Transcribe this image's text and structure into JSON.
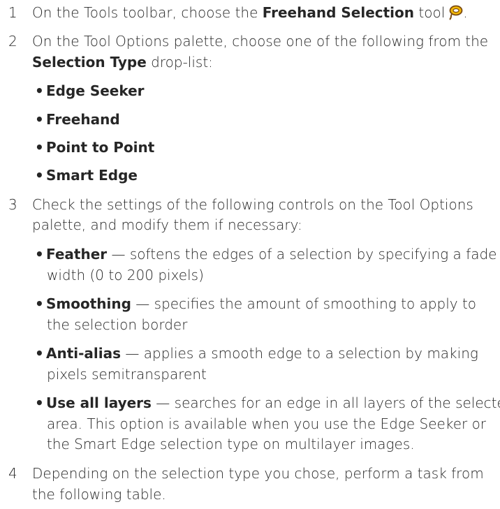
{
  "steps": [
    {
      "number": "1",
      "before": "On the Tools toolbar, choose the ",
      "keyword": "Freehand Selection",
      "after": " tool",
      "icon": "lasso-icon",
      "end": "."
    },
    {
      "number": "2",
      "line1": "On the Tool Options palette, choose one of the following from the",
      "keyword": "Selection Type",
      "line2_after": " drop-list:",
      "options": [
        "Edge Seeker",
        "Freehand",
        "Point to Point",
        "Smart Edge"
      ]
    },
    {
      "number": "3",
      "line1": "Check the settings of the following controls on the Tool Options",
      "line2": "palette, and modify them if necessary:",
      "controls": [
        {
          "name": "Feather",
          "line1": " — softens the edges of a selection by specifying a fade",
          "line2": "width (0 to 200 pixels)"
        },
        {
          "name": "Smoothing",
          "line1": " — specifies the amount of smoothing to apply to",
          "line2": "the selection border"
        },
        {
          "name": "Anti-alias",
          "line1": " — applies a smooth edge to a selection by making",
          "line2": "pixels semitransparent"
        },
        {
          "name": "Use all layers",
          "line1": " — searches for an edge in all layers of the selected",
          "line2": "area. This option is available when you use the Edge Seeker or",
          "line3": "the Smart Edge selection type on multilayer images."
        }
      ]
    },
    {
      "number": "4",
      "line1": "Depending on the selection type you chose, perform a task from",
      "line2": "the following table."
    }
  ],
  "colors": {
    "text": "#262626",
    "icon_fill": "#f2b705",
    "icon_stroke": "#7a4a12"
  }
}
